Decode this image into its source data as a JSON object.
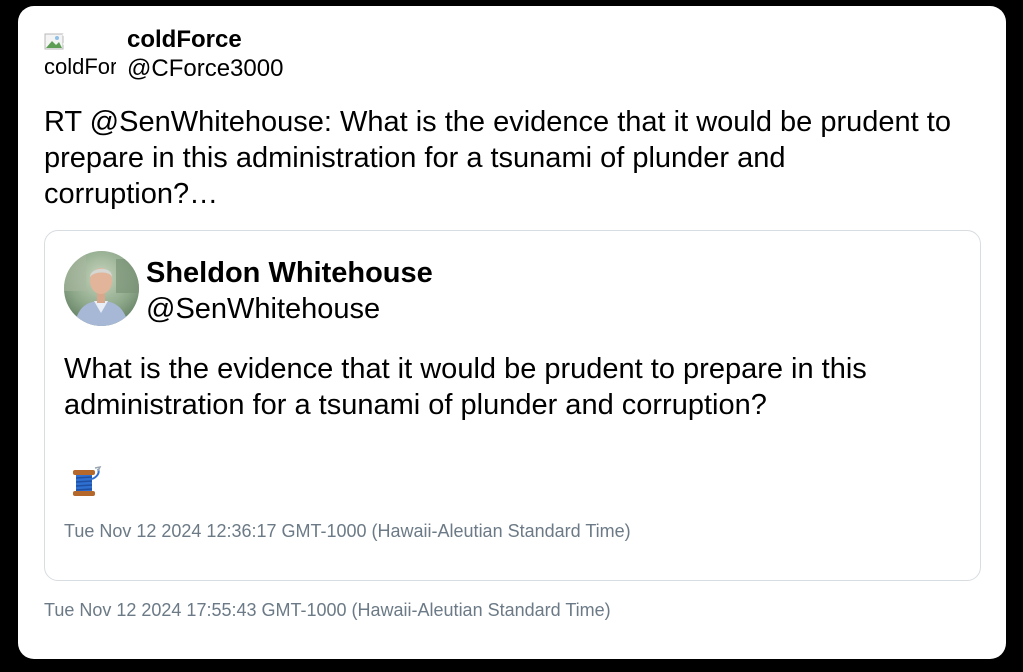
{
  "tweet": {
    "author": {
      "display_name": "coldForce",
      "handle": "@CForce3000",
      "avatar_alt": "coldForce"
    },
    "text": "RT @SenWhitehouse: What is the evidence that it would be prudent to prepare in this administration for a tsunami of plunder and corruption?…",
    "timestamp": "Tue Nov 12 2024 17:55:43 GMT-1000 (Hawaii-Aleutian Standard Time)"
  },
  "quoted_tweet": {
    "author": {
      "display_name": "Sheldon Whitehouse",
      "handle": "@SenWhitehouse"
    },
    "text": "What is the evidence that it would be prudent to prepare in this administration for a tsunami of plunder and corruption?",
    "emoji_icon": "thread-spool-icon",
    "timestamp": "Tue Nov 12 2024 12:36:17 GMT-1000 (Hawaii-Aleutian Standard Time)"
  },
  "colors": {
    "background": "#000000",
    "card": "#ffffff",
    "border": "#d8dde1",
    "timestamp": "#6b7a86"
  }
}
